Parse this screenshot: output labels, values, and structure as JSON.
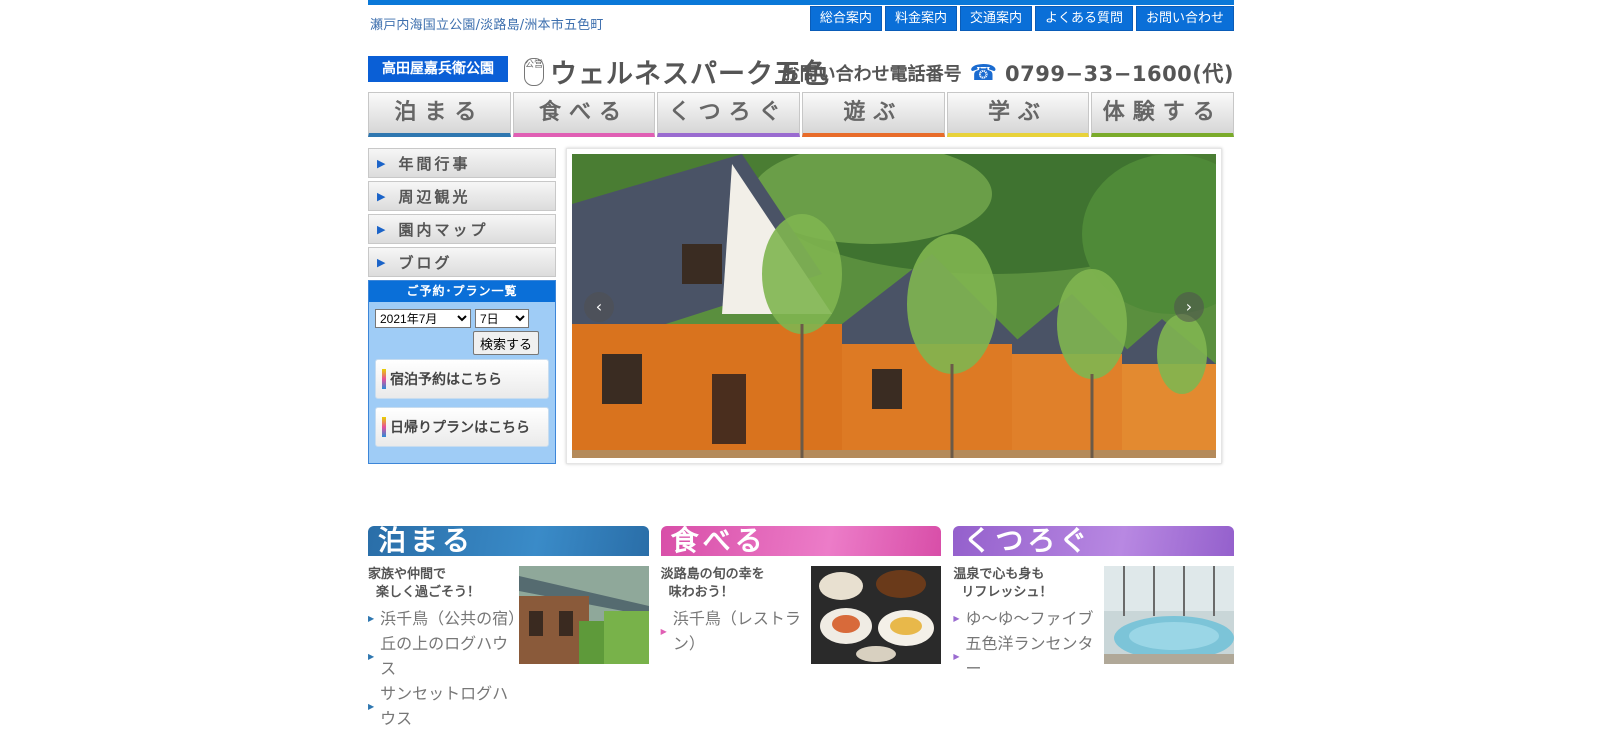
{
  "header": {
    "location": "瀬戸内海国立公園/淡路島/洲本市五色町",
    "topnav": [
      "総合案内",
      "料金案内",
      "交通案内",
      "よくある質問",
      "お問い合わせ"
    ],
    "park_badge": "高田屋嘉兵衛公園",
    "logo_mark": "公営",
    "logo_text": "ウェルネスパーク五色",
    "contact_label": "お問い合わせ電話番号",
    "phone": "0799−33−1600(代)"
  },
  "mainnav": [
    {
      "label": "泊まる",
      "color": "#2f77b0"
    },
    {
      "label": "食べる",
      "color": "#e05fb4"
    },
    {
      "label": "くつろぐ",
      "color": "#9a6bd0"
    },
    {
      "label": "遊ぶ",
      "color": "#e86c2a"
    },
    {
      "label": "学ぶ",
      "color": "#e8d23a"
    },
    {
      "label": "体験する",
      "color": "#7aab2a"
    }
  ],
  "sidebar": {
    "links": [
      "年間行事",
      "周辺観光",
      "園内マップ",
      "ブログ"
    ],
    "booking": {
      "title": "ご予約･プラン一覧",
      "month": "2021年7月",
      "day": "7日",
      "search": "検索する",
      "stay_button": "宿泊予約はこちら",
      "day_button": "日帰りプランはこちら"
    }
  },
  "slider": {
    "prev": "‹",
    "next": "›"
  },
  "categories": [
    {
      "title": "泊まる",
      "color": "#2f77b0",
      "tagline_1": "家族や仲間で",
      "tagline_2": "楽しく過ごそう！",
      "links": [
        "浜千鳥（公共の宿）",
        "丘の上のログハウス",
        "サンセットログハウス"
      ]
    },
    {
      "title": "食べる",
      "color": "#e05fb4",
      "tagline_1": "淡路島の旬の幸を",
      "tagline_2": "味わおう！",
      "links": [
        "浜千鳥（レストラン）"
      ]
    },
    {
      "title": "くつろぐ",
      "color": "#9a6bd0",
      "tagline_1": "温泉で心も身も",
      "tagline_2": "リフレッシュ！",
      "links": [
        "ゆ〜ゆ〜ファイブ",
        "五色洋ランセンター"
      ]
    }
  ]
}
